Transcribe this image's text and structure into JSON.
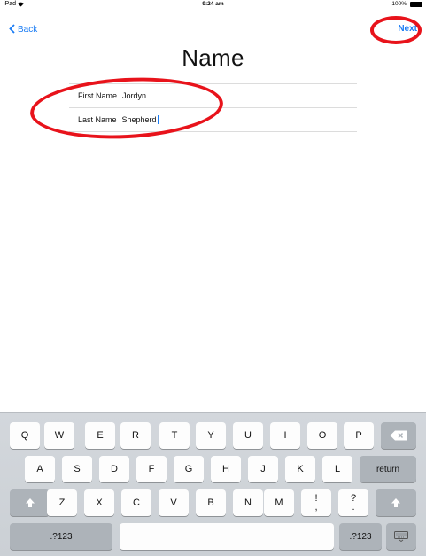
{
  "status_bar": {
    "carrier": "iPad",
    "wifi_icon": "wifi-icon",
    "time": "9:24 am",
    "battery": "100%"
  },
  "nav": {
    "back_label": "Back",
    "next_label": "Next"
  },
  "title": "Name",
  "form": {
    "first_name_label": "First Name",
    "first_name_value": "Jordyn",
    "last_name_label": "Last Name",
    "last_name_value": "Shepherd"
  },
  "keyboard": {
    "row1": [
      "Q",
      "W",
      "E",
      "R",
      "T",
      "Y",
      "U",
      "I",
      "O",
      "P"
    ],
    "row2": [
      "A",
      "S",
      "D",
      "F",
      "G",
      "H",
      "J",
      "K",
      "L"
    ],
    "return_label": "return",
    "row3": [
      "Z",
      "X",
      "C",
      "V",
      "B",
      "N",
      "M"
    ],
    "punct1": {
      "top": "!",
      "bottom": ","
    },
    "punct2": {
      "top": "?",
      "bottom": "."
    },
    "numbers_label": ".?123",
    "numbers_label_right": ".?123"
  },
  "annotation_color": "#e8131b",
  "accent_color": "#1a7cf4"
}
